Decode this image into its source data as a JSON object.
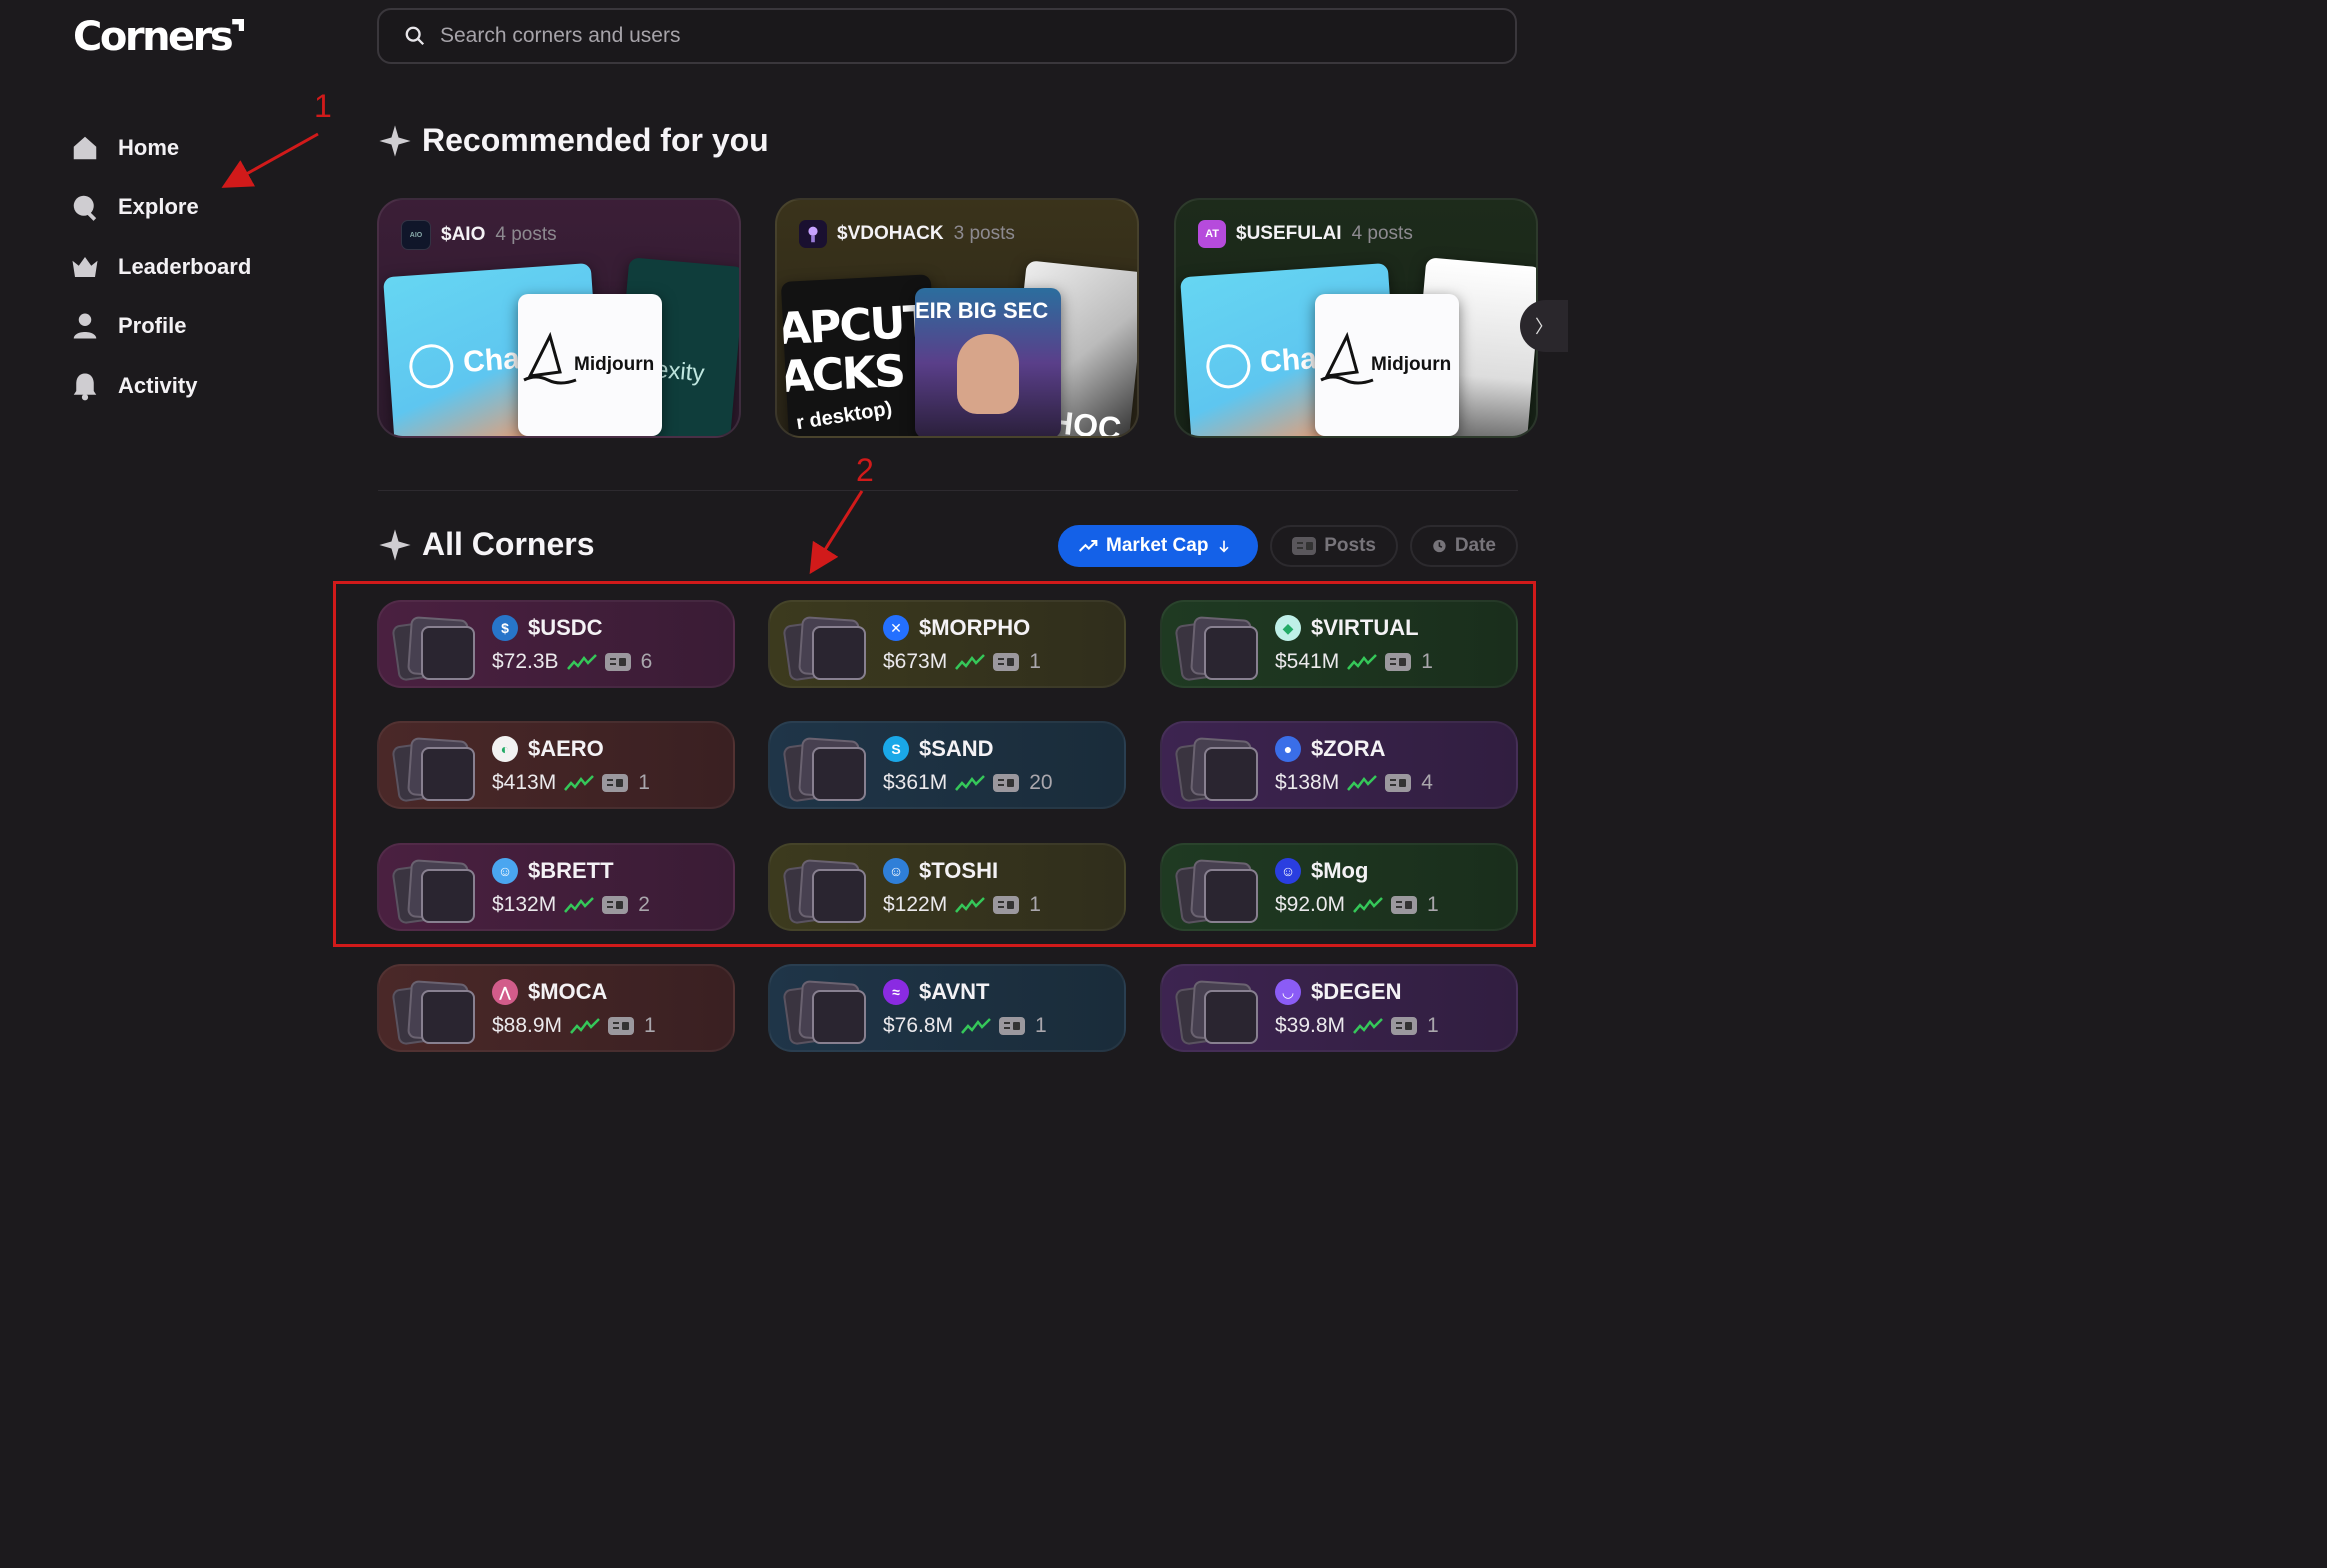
{
  "brand": {
    "name": "Corners"
  },
  "nav": [
    {
      "label": "Home",
      "icon": "home-icon"
    },
    {
      "label": "Explore",
      "icon": "search-icon"
    },
    {
      "label": "Leaderboard",
      "icon": "crown-icon"
    },
    {
      "label": "Profile",
      "icon": "user-icon"
    },
    {
      "label": "Activity",
      "icon": "bell-icon"
    }
  ],
  "search": {
    "placeholder": "Search corners and users"
  },
  "recommended": {
    "title": "Recommended for you",
    "cards": [
      {
        "ticker": "$AIO",
        "posts": "4 posts",
        "icon_text": "AIO",
        "thumb_texts": [
          "Cha",
          "Midjourn",
          "lexity"
        ]
      },
      {
        "ticker": "$VDOHACK",
        "posts": "3 posts",
        "icon_text": "",
        "thumb_texts": [
          "APCUT",
          "ACKS",
          "r desktop)",
          "EIR BIG SEC",
          "HOC"
        ]
      },
      {
        "ticker": "$USEFULAI",
        "posts": "4 posts",
        "icon_text": "AT",
        "thumb_texts": [
          "Cha",
          "Midjourn"
        ]
      }
    ]
  },
  "all_corners": {
    "title": "All Corners",
    "sort_options": [
      {
        "label": "Market Cap",
        "active": true
      },
      {
        "label": "Posts",
        "active": false
      },
      {
        "label": "Date",
        "active": false
      }
    ],
    "items": [
      {
        "ticker": "$USDC",
        "market_cap": "$72.3B",
        "posts": "6",
        "icon_color": "#2775ca",
        "icon_glyph": "$"
      },
      {
        "ticker": "$MORPHO",
        "market_cap": "$673M",
        "posts": "1",
        "icon_color": "#2470ff",
        "icon_glyph": "✕"
      },
      {
        "ticker": "$VIRTUAL",
        "market_cap": "$541M",
        "posts": "1",
        "icon_color": "#bff0e8",
        "icon_glyph": "◆"
      },
      {
        "ticker": "$AERO",
        "market_cap": "$413M",
        "posts": "1",
        "icon_color": "#f2f2f2",
        "icon_glyph": "◐"
      },
      {
        "ticker": "$SAND",
        "market_cap": "$361M",
        "posts": "20",
        "icon_color": "#1aa8e8",
        "icon_glyph": "S"
      },
      {
        "ticker": "$ZORA",
        "market_cap": "$138M",
        "posts": "4",
        "icon_color": "#3a6ee8",
        "icon_glyph": "●"
      },
      {
        "ticker": "$BRETT",
        "market_cap": "$132M",
        "posts": "2",
        "icon_color": "#4aa6f0",
        "icon_glyph": "☺"
      },
      {
        "ticker": "$TOSHI",
        "market_cap": "$122M",
        "posts": "1",
        "icon_color": "#2f7fd8",
        "icon_glyph": "☺"
      },
      {
        "ticker": "$Mog",
        "market_cap": "$92.0M",
        "posts": "1",
        "icon_color": "#2a3ee0",
        "icon_glyph": "☺"
      },
      {
        "ticker": "$MOCA",
        "market_cap": "$88.9M",
        "posts": "1",
        "icon_color": "#d25c8a",
        "icon_glyph": "⋀"
      },
      {
        "ticker": "$AVNT",
        "market_cap": "$76.8M",
        "posts": "1",
        "icon_color": "#8a2be2",
        "icon_glyph": "≈"
      },
      {
        "ticker": "$DEGEN",
        "market_cap": "$39.8M",
        "posts": "1",
        "icon_color": "#8b5cf6",
        "icon_glyph": "◡"
      }
    ]
  },
  "annotations": [
    {
      "label": "1"
    },
    {
      "label": "2"
    }
  ],
  "colors": {
    "accent": "#1461e8",
    "highlight": "#d11a1a",
    "trend": "#35c759"
  }
}
